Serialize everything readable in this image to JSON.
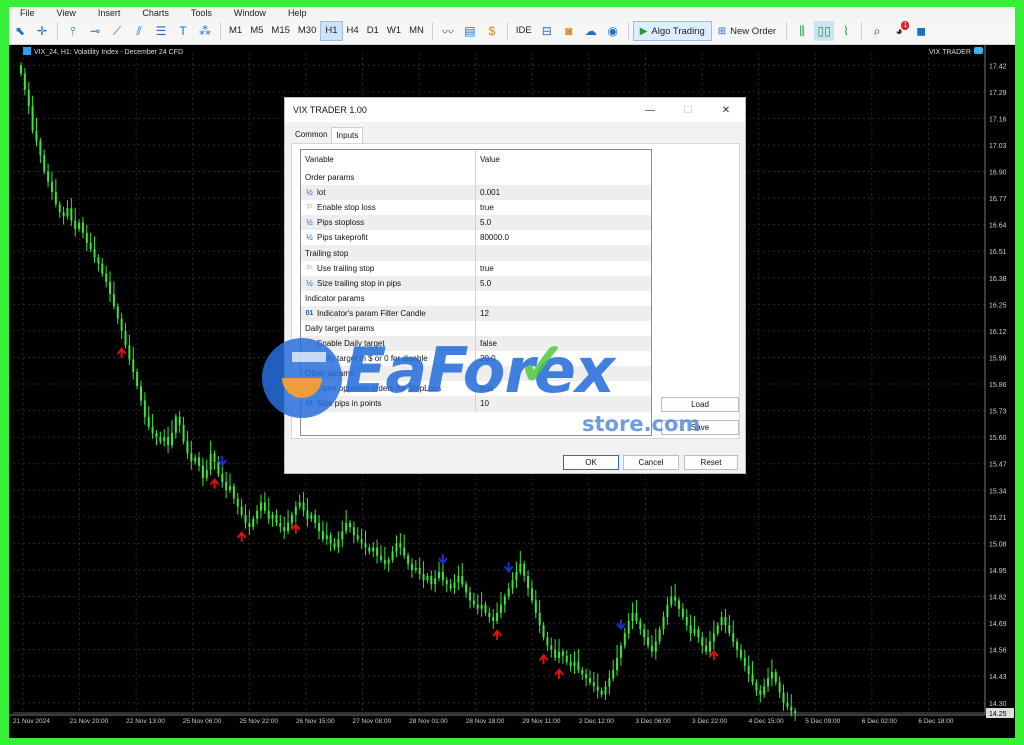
{
  "menu": [
    "File",
    "View",
    "Insert",
    "Charts",
    "Tools",
    "Window",
    "Help"
  ],
  "toolbar": {
    "timeframes": [
      "M1",
      "M5",
      "M15",
      "M30",
      "H1",
      "H4",
      "D1",
      "W1",
      "MN"
    ],
    "active_timeframe": "H1",
    "ide_label": "IDE",
    "algo_trading_label": "Algo Trading",
    "new_order_label": "New Order",
    "notification_count": "1"
  },
  "chart": {
    "title": "VIX_24, H1:  Volatility Index - December 24 CFD",
    "ea_label": "VIX TRADER",
    "current_price": "14.25"
  },
  "chart_data": {
    "type": "candlestick",
    "symbol": "VIX_24",
    "timeframe": "H1",
    "price_ticks": [
      "17.42",
      "17.29",
      "17.16",
      "17.03",
      "16.90",
      "16.77",
      "16.64",
      "16.51",
      "16.38",
      "16.25",
      "16.12",
      "15.99",
      "15.86",
      "15.73",
      "15.60",
      "15.47",
      "15.34",
      "15.21",
      "15.08",
      "14.95",
      "14.82",
      "14.69",
      "14.56",
      "14.43",
      "14.30"
    ],
    "time_ticks": [
      "21 Nov 2024",
      "21 Nov 20:00",
      "22 Nov 13:00",
      "25 Nov 06:00",
      "25 Nov 22:00",
      "26 Nov 15:00",
      "27 Nov 08:00",
      "28 Nov 01:00",
      "28 Nov 18:00",
      "29 Nov 11:00",
      "2 Dec 12:00",
      "3 Dec 06:00",
      "3 Dec 22:00",
      "4 Dec 15:00",
      "5 Dec 09:00",
      "6 Dec 02:00",
      "6 Dec 18:00"
    ],
    "ylim": [
      14.25,
      17.48
    ],
    "close": [
      17.38,
      17.3,
      17.22,
      17.1,
      17.05,
      16.98,
      16.9,
      16.85,
      16.8,
      16.74,
      16.7,
      16.68,
      16.72,
      16.66,
      16.62,
      16.65,
      16.6,
      16.55,
      16.52,
      16.48,
      16.45,
      16.4,
      16.36,
      16.3,
      16.24,
      16.18,
      16.12,
      16.05,
      15.98,
      15.92,
      15.85,
      15.78,
      15.7,
      15.65,
      15.62,
      15.6,
      15.58,
      15.6,
      15.56,
      15.62,
      15.7,
      15.66,
      15.58,
      15.52,
      15.48,
      15.5,
      15.46,
      15.4,
      15.44,
      15.52,
      15.48,
      15.42,
      15.38,
      15.34,
      15.36,
      15.3,
      15.26,
      15.22,
      15.18,
      15.16,
      15.2,
      15.24,
      15.28,
      15.24,
      15.2,
      15.22,
      15.18,
      15.16,
      15.14,
      15.18,
      15.22,
      15.26,
      15.28,
      15.24,
      15.2,
      15.22,
      15.18,
      15.14,
      15.1,
      15.12,
      15.08,
      15.06,
      15.1,
      15.14,
      15.18,
      15.16,
      15.12,
      15.1,
      15.08,
      15.06,
      15.04,
      15.06,
      15.02,
      15.0,
      14.98,
      15.0,
      15.04,
      15.08,
      15.06,
      15.02,
      14.98,
      14.95,
      14.96,
      14.93,
      14.9,
      14.92,
      14.88,
      14.91,
      14.94,
      14.9,
      14.88,
      14.86,
      14.89,
      14.92,
      14.88,
      14.84,
      14.8,
      14.78,
      14.76,
      14.78,
      14.74,
      14.72,
      14.7,
      14.74,
      14.78,
      14.82,
      14.86,
      14.9,
      14.94,
      14.98,
      14.92,
      14.86,
      14.8,
      14.74,
      14.68,
      14.62,
      14.58,
      14.56,
      14.52,
      14.55,
      14.53,
      14.5,
      14.48,
      14.5,
      14.46,
      14.44,
      14.42,
      14.4,
      14.38,
      14.36,
      14.34,
      14.38,
      14.42,
      14.46,
      14.52,
      14.58,
      14.64,
      14.7,
      14.74,
      14.7,
      14.66,
      14.62,
      14.58,
      14.55,
      14.6,
      14.66,
      14.72,
      14.78,
      14.82,
      14.8,
      14.76,
      14.72,
      14.68,
      14.64,
      14.66,
      14.62,
      14.58,
      14.55,
      14.6,
      14.64,
      14.68,
      14.72,
      14.68,
      14.64,
      14.6,
      14.56,
      14.52,
      14.48,
      14.44,
      14.4,
      14.36,
      14.34,
      14.38,
      14.42,
      14.45,
      14.4,
      14.35,
      14.3,
      14.28,
      14.26,
      14.25
    ],
    "buy_arrows": [
      0.127,
      0.25,
      0.285,
      0.352,
      0.612,
      0.672,
      0.69,
      0.893
    ],
    "sell_arrows": [
      0.261,
      0.54,
      0.629,
      0.77
    ]
  },
  "dialog": {
    "title": "VIX TRADER 1.00",
    "tabs": [
      "Common",
      "Inputs"
    ],
    "active_tab": "Inputs",
    "col_variable": "Variable",
    "col_value": "Value",
    "rows": [
      {
        "icon": "none",
        "name": "Order params",
        "value": ""
      },
      {
        "icon": "half",
        "name": "lot",
        "value": "0.001"
      },
      {
        "icon": "flag",
        "name": "Enable stop loss",
        "value": "true"
      },
      {
        "icon": "half",
        "name": "Pips stoploss",
        "value": "5.0"
      },
      {
        "icon": "half",
        "name": "Pips takeprofit",
        "value": "80000.0"
      },
      {
        "icon": "none",
        "name": "Trailing stop",
        "value": ""
      },
      {
        "icon": "flag",
        "name": "Use trailing stop",
        "value": "true"
      },
      {
        "icon": "half",
        "name": "Size trailing stop in pips",
        "value": "5.0"
      },
      {
        "icon": "none",
        "name": "Indicator params",
        "value": ""
      },
      {
        "icon": "num",
        "name": "Indicator's param Filter Candle",
        "value": "12"
      },
      {
        "icon": "none",
        "name": "Daily target params",
        "value": ""
      },
      {
        "icon": "flag",
        "name": "Enable Daily target",
        "value": "false"
      },
      {
        "icon": "half",
        "name": "Daily target in $ or 0 for disable",
        "value": "20.0"
      },
      {
        "icon": "none",
        "name": "Other params",
        "value": ""
      },
      {
        "icon": "flag",
        "name": "Open opposite orders for StopLoss",
        "value": "true"
      },
      {
        "icon": "num",
        "name": "Size pips in points",
        "value": "10"
      }
    ],
    "load_label": "Load",
    "save_label": "Save",
    "ok_label": "OK",
    "cancel_label": "Cancel",
    "reset_label": "Reset"
  },
  "watermark": {
    "brand": "EaForex",
    "sub": "store.com"
  },
  "colors": {
    "frame": "#35f035",
    "bull": "#39e639",
    "buy_arrow": "#e01010",
    "sell_arrow": "#2030d0",
    "grid": "#2a2a2a"
  }
}
